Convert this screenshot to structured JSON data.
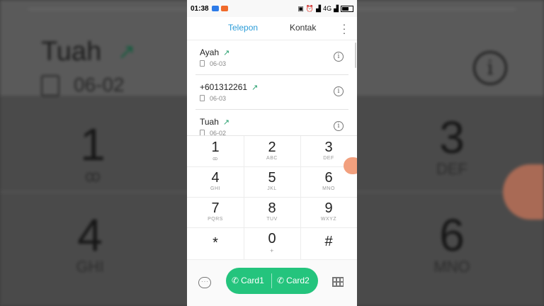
{
  "status_bar": {
    "time": "01:38",
    "network": "4G",
    "colors": {
      "msg": "#2d7be8",
      "weibo": "#f06a2a"
    }
  },
  "tabs": {
    "phone": "Telepon",
    "contacts": "Kontak",
    "accent": "#2b9cd8"
  },
  "call_log": [
    {
      "name": "Ayah",
      "date": "06-03"
    },
    {
      "name": "+601312261",
      "date": "06-03"
    },
    {
      "name": "Tuah",
      "date": "06-02"
    }
  ],
  "keypad": [
    {
      "num": "1",
      "letters": "ꝏ"
    },
    {
      "num": "2",
      "letters": "ABC"
    },
    {
      "num": "3",
      "letters": "DEF"
    },
    {
      "num": "4",
      "letters": "GHI"
    },
    {
      "num": "5",
      "letters": "JKL"
    },
    {
      "num": "6",
      "letters": "MNO"
    },
    {
      "num": "7",
      "letters": "PQRS"
    },
    {
      "num": "8",
      "letters": "TUV"
    },
    {
      "num": "9",
      "letters": "WXYZ"
    },
    {
      "num": "*",
      "letters": ""
    },
    {
      "num": "0",
      "letters": "+"
    },
    {
      "num": "#",
      "letters": ""
    }
  ],
  "bottom": {
    "card1": "Card1",
    "card2": "Card2",
    "call_color": "#24c47d"
  },
  "background": {
    "name": "Tuah",
    "date": "06-02",
    "keys": [
      {
        "num": "1",
        "letters": "ꝏ"
      },
      {
        "num": "3",
        "letters": "DEF"
      },
      {
        "num": "4",
        "letters": "GHI"
      },
      {
        "num": "6",
        "letters": "MNO"
      }
    ]
  }
}
